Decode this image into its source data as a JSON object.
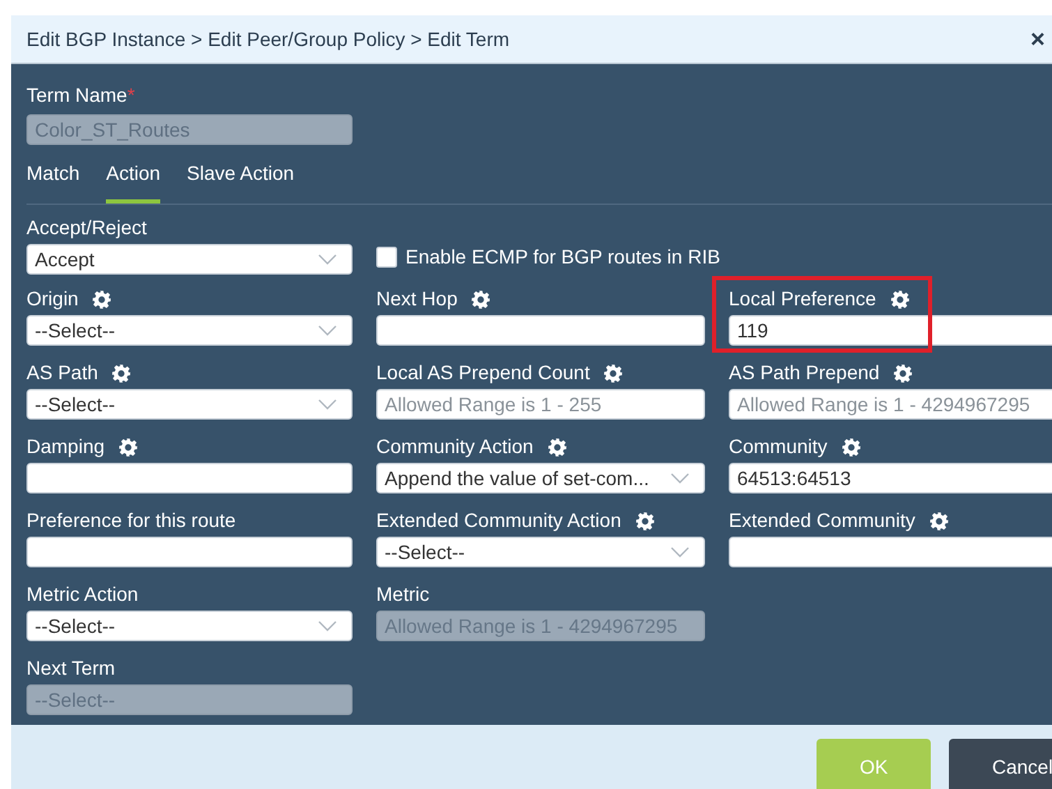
{
  "dialog": {
    "title": "Edit BGP Instance > Edit Peer/Group Policy > Edit Term",
    "close": "×"
  },
  "term_name": {
    "label": "Term Name",
    "required": "*",
    "value": "Color_ST_Routes",
    "disabled": true
  },
  "tabs": [
    {
      "label": "Match",
      "selected": false
    },
    {
      "label": "Action",
      "selected": true
    },
    {
      "label": "Slave Action",
      "selected": false
    }
  ],
  "rows": [
    [
      {
        "kind": "select",
        "label": "Accept/Reject",
        "gear": false,
        "value": "Accept",
        "disabled": false,
        "highlighted": false
      },
      {
        "kind": "checkbox",
        "label": "Enable ECMP for BGP routes in RIB",
        "checked": false
      }
    ],
    [
      {
        "kind": "select",
        "label": "Origin",
        "gear": true,
        "value": "--Select--",
        "disabled": false,
        "highlighted": false
      },
      {
        "kind": "input",
        "label": "Next Hop",
        "gear": true,
        "disabled": false,
        "highlighted": false
      },
      {
        "kind": "input",
        "label": "Local Preference",
        "gear": true,
        "value": "119",
        "disabled": false,
        "highlighted": true
      }
    ],
    [
      {
        "kind": "select",
        "label": "AS Path",
        "gear": true,
        "value": "--Select--",
        "disabled": false,
        "highlighted": false
      },
      {
        "kind": "input",
        "label": "Local AS Prepend Count",
        "gear": true,
        "placeholder": "Allowed Range is 1 - 255",
        "disabled": false,
        "highlighted": false
      },
      {
        "kind": "input",
        "label": "AS Path Prepend",
        "gear": true,
        "placeholder": "Allowed Range is 1 - 4294967295",
        "disabled": false,
        "highlighted": false
      }
    ],
    [
      {
        "kind": "input",
        "label": "Damping",
        "gear": true,
        "disabled": false,
        "highlighted": false
      },
      {
        "kind": "select",
        "label": "Community Action",
        "gear": true,
        "value": "Append the value of set-com...",
        "disabled": false,
        "highlighted": false
      },
      {
        "kind": "input",
        "label": "Community",
        "gear": true,
        "value": "64513:64513",
        "disabled": false,
        "highlighted": false
      }
    ],
    [
      {
        "kind": "input",
        "label": "Preference for this route",
        "gear": false,
        "disabled": false,
        "highlighted": false
      },
      {
        "kind": "select",
        "label": "Extended Community Action",
        "gear": true,
        "value": "--Select--",
        "disabled": false,
        "highlighted": false
      },
      {
        "kind": "input",
        "label": "Extended Community",
        "gear": true,
        "disabled": false,
        "highlighted": false
      }
    ],
    [
      {
        "kind": "select",
        "label": "Metric Action",
        "gear": false,
        "value": "--Select--",
        "disabled": false,
        "highlighted": false
      },
      {
        "kind": "input",
        "label": "Metric",
        "gear": false,
        "placeholder": "Allowed Range is 1 - 4294967295",
        "disabled": true,
        "highlighted": false
      }
    ],
    [
      {
        "kind": "select",
        "label": "Next Term",
        "gear": false,
        "value": "--Select--",
        "disabled": true,
        "highlighted": false
      }
    ]
  ],
  "buttons": [
    {
      "label": "OK",
      "kind": "primary"
    },
    {
      "label": "Cancel",
      "kind": "secondary"
    }
  ]
}
